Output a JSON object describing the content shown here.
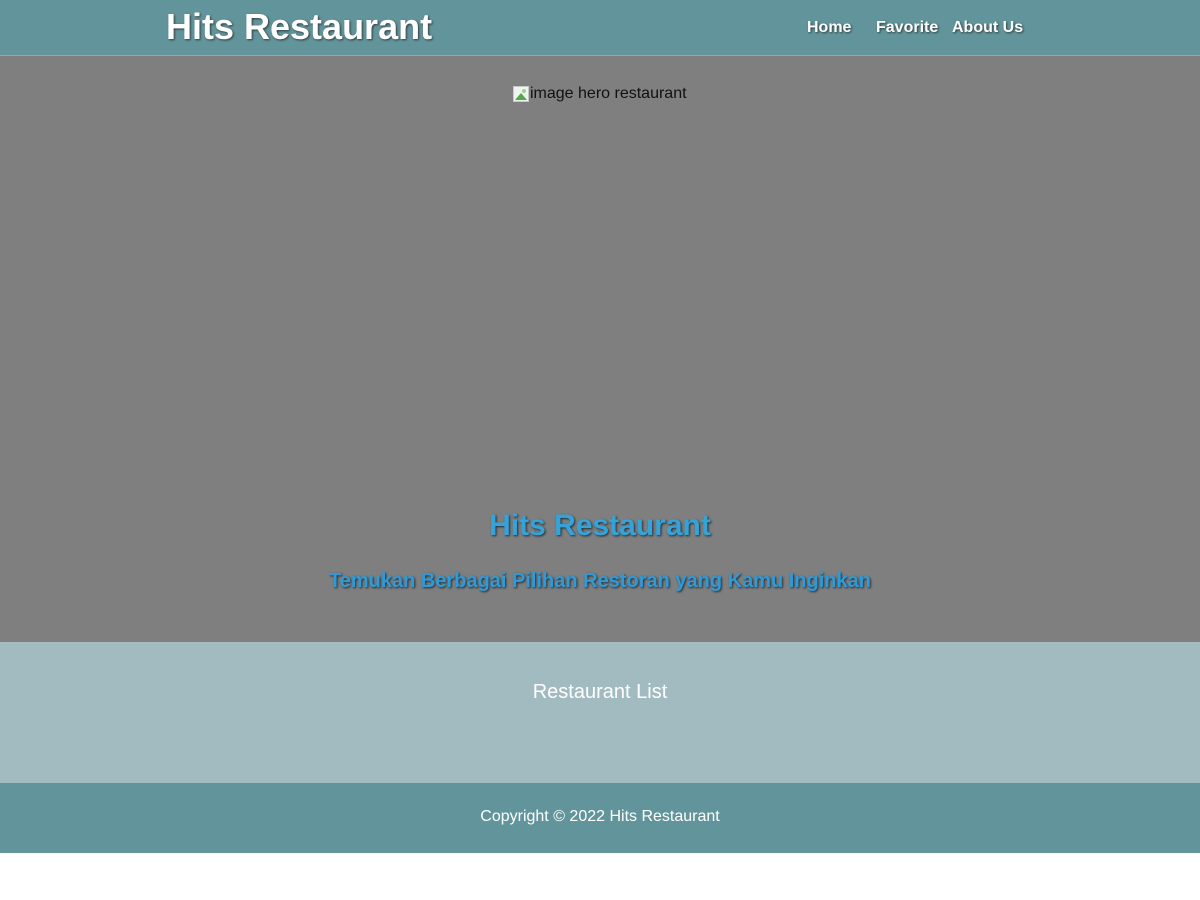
{
  "header": {
    "brand": "Hits Restaurant",
    "nav": [
      {
        "label": "Home"
      },
      {
        "label": "Favorite"
      },
      {
        "label": "About Us"
      }
    ]
  },
  "hero": {
    "image_alt": "image hero restaurant",
    "title": "Hits Restaurant",
    "subtitle": "Temukan Berbagai Pilihan Restoran yang Kamu Inginkan"
  },
  "content": {
    "title": "Restaurant List"
  },
  "footer": {
    "copyright": "Copyright © 2022 Hits Restaurant"
  },
  "colors": {
    "app_bar": "#62959b",
    "hero_overlay": "#7f7f7f",
    "hero_text": "#36a3d8",
    "content_bg": "#a1bbc1",
    "footer": "#62959b"
  }
}
